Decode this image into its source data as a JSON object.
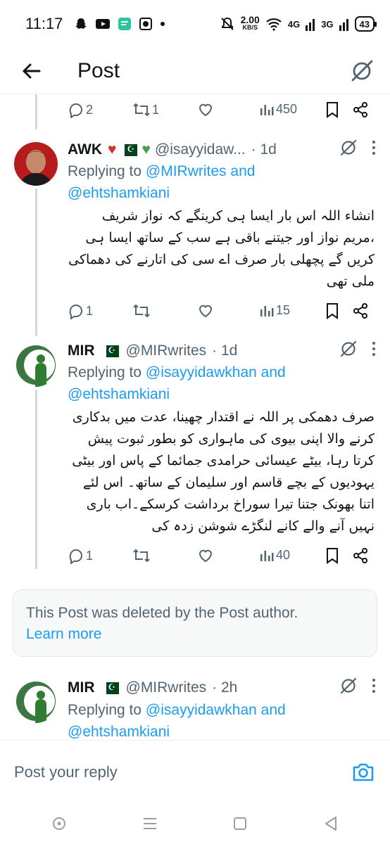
{
  "status_bar": {
    "time": "11:17",
    "net_speed_value": "2.00",
    "net_speed_unit": "KB/S",
    "net1": "4G",
    "net2": "3G",
    "battery": "43"
  },
  "header": {
    "title": "Post"
  },
  "top_actions": {
    "replies": "2",
    "reposts": "1",
    "views": "450"
  },
  "tweets": [
    {
      "name": "AWK",
      "handle": "@isayyidaw...",
      "time": "· 1d",
      "replying_prefix": "Replying to",
      "mention1": "@MIRwrites",
      "and": "and",
      "mention2": "@ehtshamkiani",
      "body": "انشاء اللہ اس بار ایسا ہی کرینگے کہ نواز شریف ،مریم نواز اور جیتنے باقی ہے سب کے ساتھ ایسا ہی کریں گے پچھلی بار صرف اے سی کی اتارنے کی دھماکی ملی تھی",
      "replies": "1",
      "views": "15"
    },
    {
      "name": "MIR",
      "handle": "@MIRwrites",
      "time": "· 1d",
      "replying_prefix": "Replying to",
      "mention1": "@isayyidawkhan",
      "and": "and",
      "mention2": "@ehtshamkiani",
      "body": "صرف دھمکی پر اللہ نے اقتدار چھینا، عدت میں بدکاری کرنے والا اپنی بیوی کی ماہواری کو بطور ثبوت پیش کرتا رہا، بیٹے عیسائی حرامدی جمائما کے پاس اور بیٹی یہودیوں کے بچے قاسم اور سلیمان کے ساتھ۔ اس لئے اتنا بھونک جتنا تیرا سوراخ برداشت کرسکے۔اب باری نہیں آنے والے کانے لنگڑے شوشن زدہ کی",
      "replies": "1",
      "views": "40"
    },
    {
      "name": "MIR",
      "handle": "@MIRwrites",
      "time": "· 2h",
      "replying_prefix": "Replying to",
      "mention1": "@isayyidawkhan",
      "and": "and",
      "mention2": "@ehtshamkiani"
    }
  ],
  "deleted_notice": {
    "text": "This Post was deleted by the Post author.",
    "link": "Learn more"
  },
  "reply_bar": {
    "placeholder": "Post your reply"
  },
  "colors": {
    "accent": "#1d9bf0",
    "secondary_text": "#536471",
    "thread_line": "#cfd9de"
  },
  "icons": [
    "back-arrow-icon",
    "grok-icon",
    "reply-icon",
    "repost-icon",
    "like-icon",
    "views-icon",
    "bookmark-icon",
    "share-icon",
    "more-icon",
    "camera-icon"
  ]
}
